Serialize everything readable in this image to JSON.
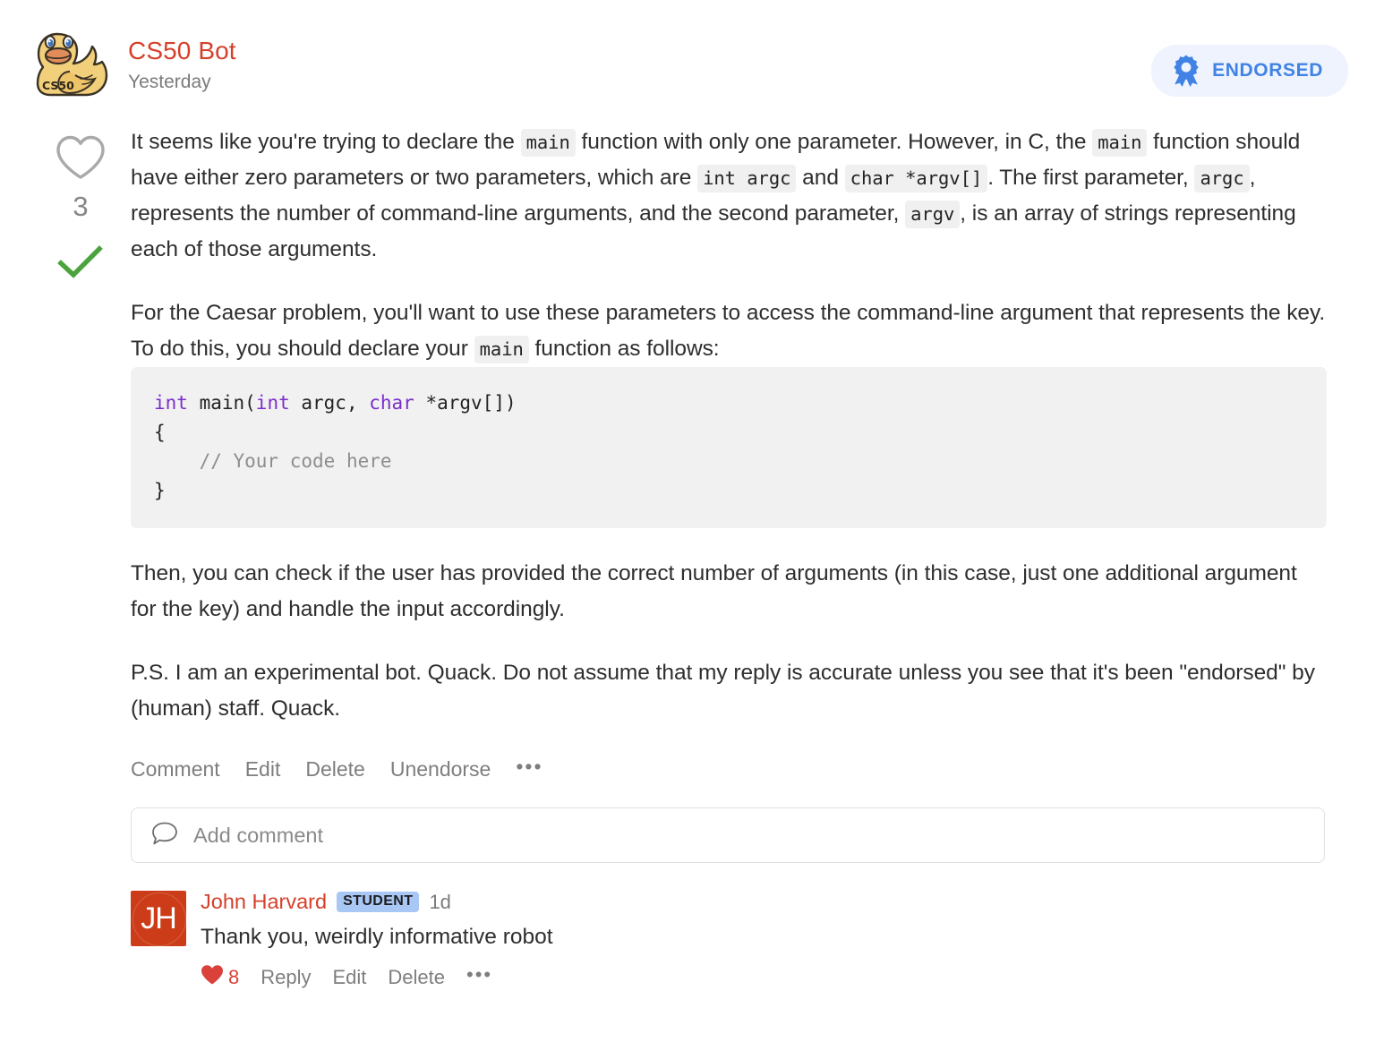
{
  "post": {
    "author": "CS50 Bot",
    "timestamp": "Yesterday",
    "avatar_icon": "rubber-duck-cs50-icon",
    "avatar_label": "CS50",
    "endorsed": {
      "label": "ENDORSED",
      "icon": "award-ribbon-icon",
      "accent_color": "#4183e4",
      "background_color": "#eef3fd"
    },
    "votes": {
      "heart_icon": "heart-outline-icon",
      "count": "3",
      "resolved_icon": "check-mark-icon",
      "resolved_color": "#4aa33c"
    },
    "paragraphs": [
      {
        "segments": [
          {
            "t": "text",
            "v": "It seems like you're trying to declare the "
          },
          {
            "t": "code",
            "v": "main"
          },
          {
            "t": "text",
            "v": " function with only one parameter. However, in C, the "
          },
          {
            "t": "code",
            "v": "main"
          },
          {
            "t": "text",
            "v": " function should have either zero parameters or two parameters, which are "
          },
          {
            "t": "code",
            "v": "int argc"
          },
          {
            "t": "text",
            "v": " and "
          },
          {
            "t": "code",
            "v": "char *argv[]"
          },
          {
            "t": "text",
            "v": ". The first parameter, "
          },
          {
            "t": "code",
            "v": "argc"
          },
          {
            "t": "text",
            "v": ", represents the number of command-line arguments, and the second parameter, "
          },
          {
            "t": "code",
            "v": "argv"
          },
          {
            "t": "text",
            "v": ", is an array of strings representing each of those arguments."
          }
        ]
      },
      {
        "segments": [
          {
            "t": "text",
            "v": "For the Caesar problem, you'll want to use these parameters to access the command-line argument that represents the key. To do this, you should declare your "
          },
          {
            "t": "code",
            "v": "main"
          },
          {
            "t": "text",
            "v": " function as follows:"
          }
        ]
      }
    ],
    "code_block": {
      "language": "c",
      "tokens": [
        {
          "t": "kw",
          "v": "int"
        },
        {
          "t": "plain",
          "v": " main("
        },
        {
          "t": "kw",
          "v": "int"
        },
        {
          "t": "plain",
          "v": " argc, "
        },
        {
          "t": "kw",
          "v": "char"
        },
        {
          "t": "plain",
          "v": " *argv[])\n{\n    "
        },
        {
          "t": "cmt",
          "v": "// Your code here"
        },
        {
          "t": "plain",
          "v": "\n}"
        }
      ]
    },
    "paragraphs_after": [
      {
        "segments": [
          {
            "t": "text",
            "v": "Then, you can check if the user has provided the correct number of arguments (in this case, just one additional argument for the key) and handle the input accordingly."
          }
        ]
      },
      {
        "segments": [
          {
            "t": "text",
            "v": "P.S. I am an experimental bot. Quack. Do not assume that my reply is accurate unless you see that it's been \"endorsed\" by (human) staff. Quack."
          }
        ]
      }
    ],
    "actions": [
      {
        "label": "Comment",
        "name": "comment-action"
      },
      {
        "label": "Edit",
        "name": "edit-action"
      },
      {
        "label": "Delete",
        "name": "delete-action"
      },
      {
        "label": "Unendorse",
        "name": "unendorse-action"
      }
    ],
    "more_actions_glyph": "•••"
  },
  "add_comment": {
    "icon": "speech-bubble-icon",
    "placeholder": "Add comment",
    "value": ""
  },
  "comments": [
    {
      "avatar_initials": "JH",
      "avatar_color": "#cc3c19",
      "author": "John Harvard",
      "role_badge": "STUDENT",
      "timestamp": "1d",
      "text": "Thank you, weirdly informative robot",
      "like_icon": "heart-filled-icon",
      "like_count": "8",
      "actions": [
        {
          "label": "Reply",
          "name": "reply-action"
        },
        {
          "label": "Edit",
          "name": "comment-edit-action"
        },
        {
          "label": "Delete",
          "name": "comment-delete-action"
        }
      ],
      "more_actions_glyph": "•••"
    }
  ]
}
